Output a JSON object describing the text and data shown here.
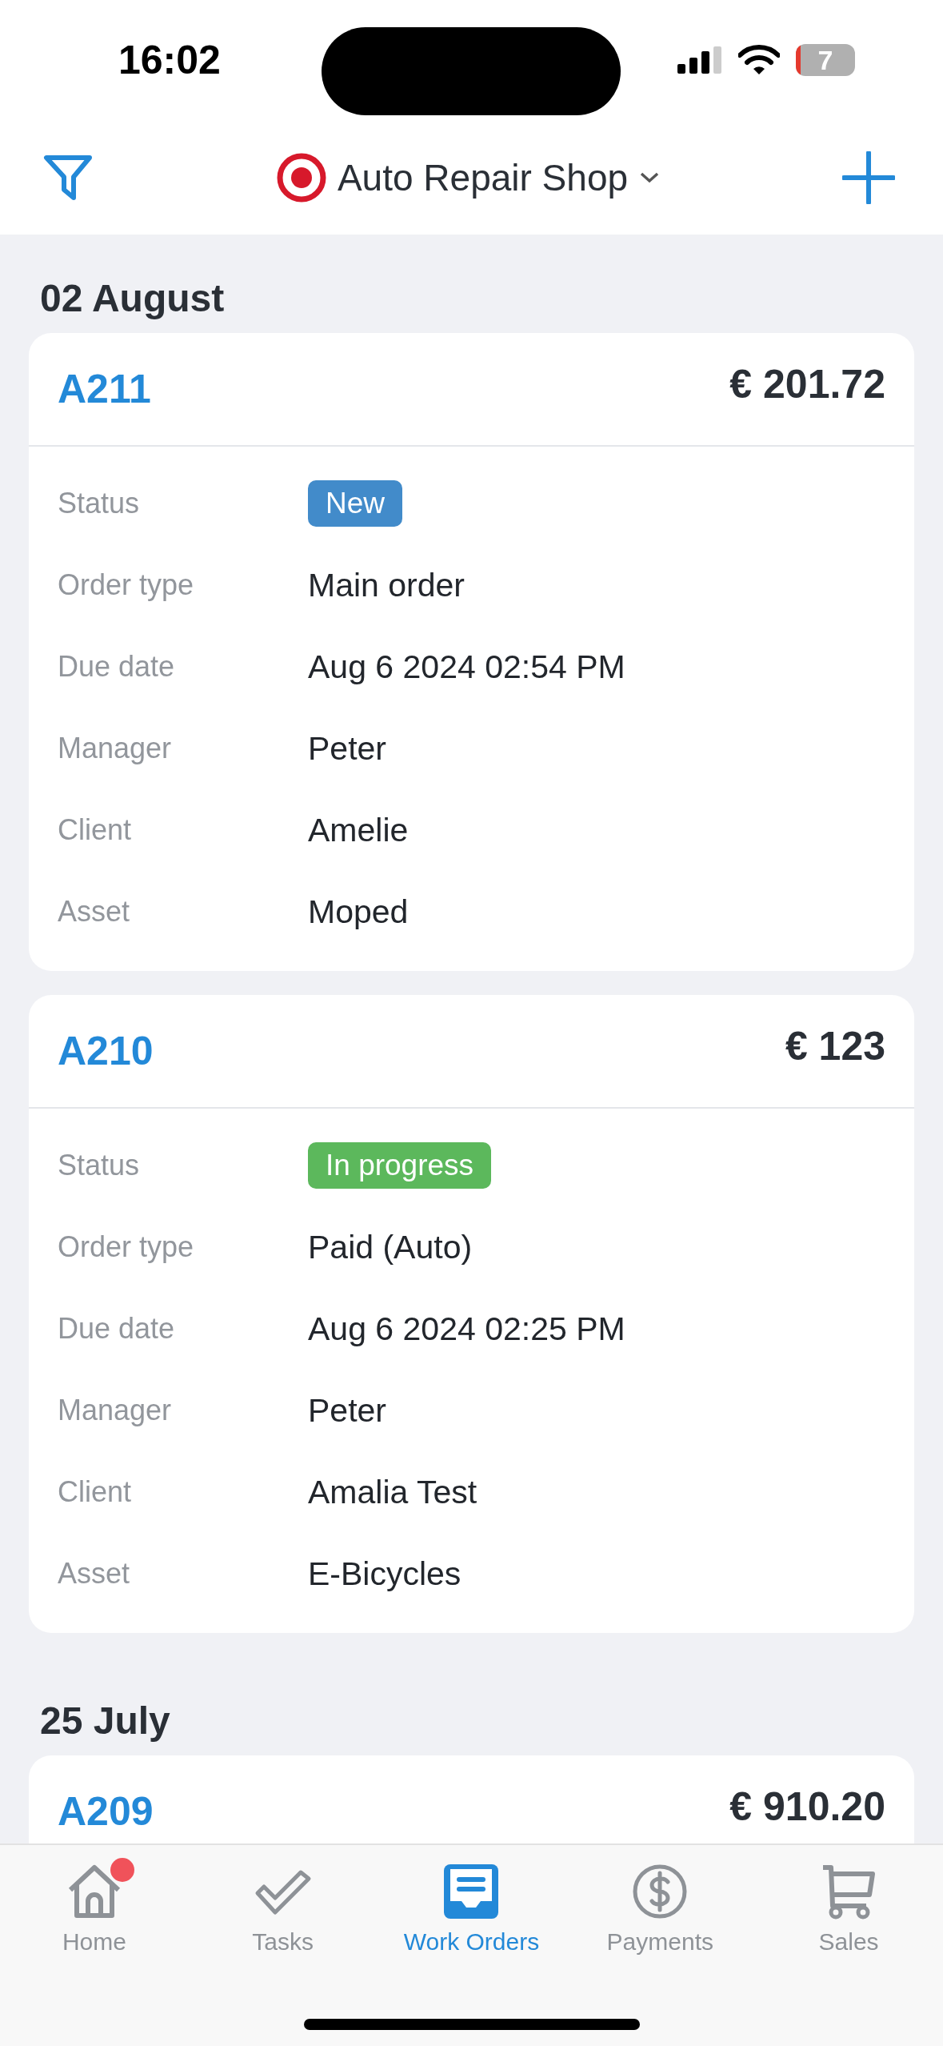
{
  "status_bar": {
    "time": "16:02",
    "battery": "7"
  },
  "header": {
    "title": "Auto Repair Shop"
  },
  "sections": [
    {
      "date": "02 August",
      "orders": [
        {
          "id": "A211",
          "amount": "€ 201.72",
          "fields": [
            {
              "label": "Status",
              "kind": "badge",
              "value": "New",
              "color": "#428bca"
            },
            {
              "label": "Order type",
              "kind": "text",
              "value": "Main order"
            },
            {
              "label": "Due date",
              "kind": "text",
              "value": "Aug 6 2024 02:54 PM"
            },
            {
              "label": "Manager",
              "kind": "text",
              "value": "Peter"
            },
            {
              "label": "Client",
              "kind": "text",
              "value": "Amelie"
            },
            {
              "label": "Asset",
              "kind": "text",
              "value": "Moped"
            }
          ]
        },
        {
          "id": "A210",
          "amount": "€ 123",
          "fields": [
            {
              "label": "Status",
              "kind": "badge",
              "value": "In progress",
              "color": "#5cb85c"
            },
            {
              "label": "Order type",
              "kind": "text",
              "value": "Paid (Auto)"
            },
            {
              "label": "Due date",
              "kind": "text",
              "value": "Aug 6 2024 02:25 PM"
            },
            {
              "label": "Manager",
              "kind": "text",
              "value": "Peter"
            },
            {
              "label": "Client",
              "kind": "text",
              "value": "Amalia Test"
            },
            {
              "label": "Asset",
              "kind": "text",
              "value": "E-Bicycles"
            }
          ]
        }
      ]
    },
    {
      "date": "25 July",
      "orders": [
        {
          "id": "A209",
          "amount": "€ 910.20"
        }
      ]
    }
  ],
  "tab_bar": [
    {
      "label": "Home",
      "kind": "home",
      "selected": false,
      "badge": true
    },
    {
      "label": "Tasks",
      "kind": "tasks",
      "selected": false,
      "badge": false
    },
    {
      "label": "Work Orders",
      "kind": "orders",
      "selected": true,
      "badge": false
    },
    {
      "label": "Payments",
      "kind": "payments",
      "selected": false,
      "badge": false
    },
    {
      "label": "Sales",
      "kind": "sales",
      "selected": false,
      "badge": false
    }
  ]
}
